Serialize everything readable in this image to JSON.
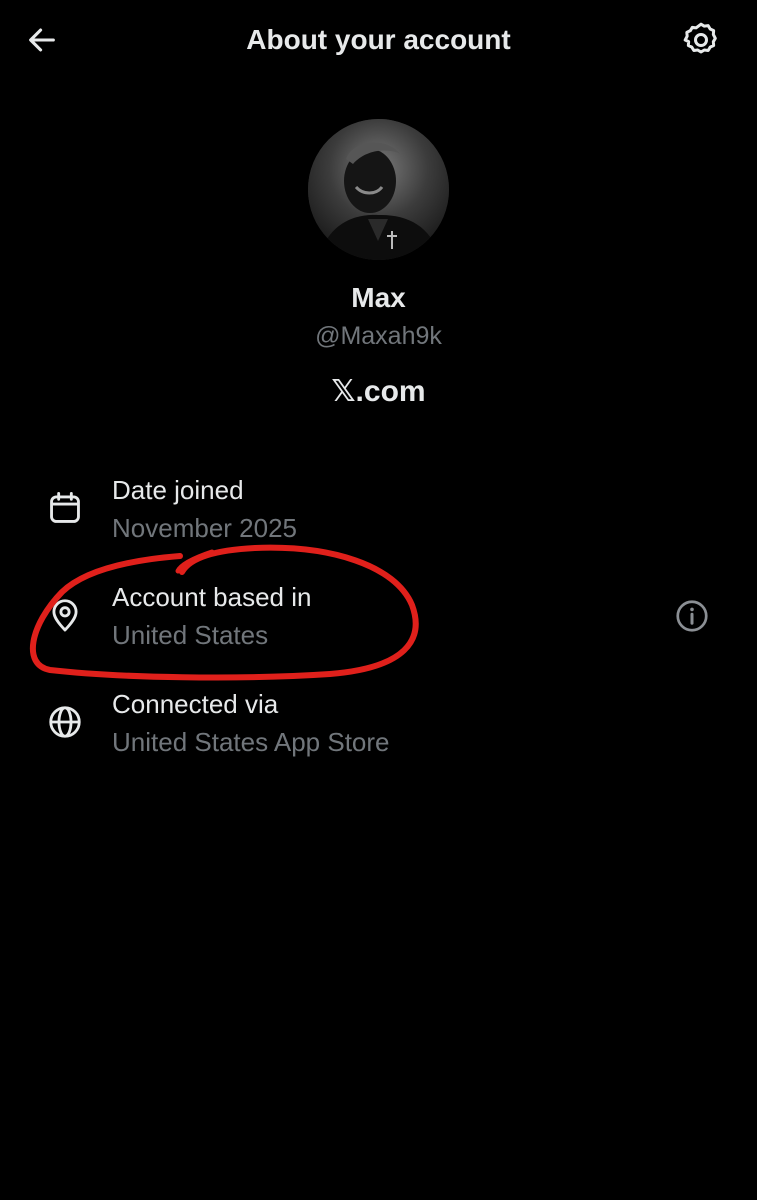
{
  "header": {
    "title": "About your account",
    "back_icon": "arrow-left-icon",
    "settings_icon": "gear-icon"
  },
  "profile": {
    "display_name": "Max",
    "handle": "@Maxah9k",
    "site": "𝕏.com"
  },
  "details": [
    {
      "icon": "calendar-icon",
      "title": "Date joined",
      "value": "November 2025"
    },
    {
      "icon": "location-pin-icon",
      "title": "Account based in",
      "value": "United States"
    },
    {
      "icon": "globe-icon",
      "title": "Connected via",
      "value": "United States App Store"
    }
  ],
  "colors": {
    "background": "#000000",
    "primary_text": "#e7e9ea",
    "secondary_text": "#71767b",
    "annotation": "#e0201b"
  }
}
